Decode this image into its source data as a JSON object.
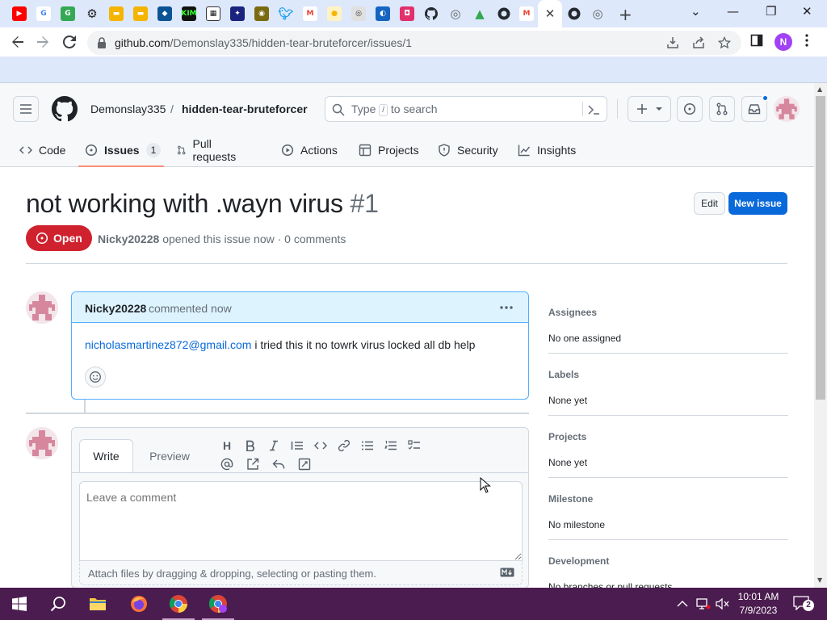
{
  "browser": {
    "tab_close": "✕",
    "new_tab": "+",
    "url_host": "github.com",
    "url_path": "/Demonslay335/hidden-tear-bruteforcer/issues/1",
    "profile_initial": "N",
    "window_controls": {
      "minimize": "—",
      "maximize": "❐",
      "close": "✕",
      "tab_search": "⌄"
    }
  },
  "github": {
    "owner": "Demonslay335",
    "slash": "/",
    "repo": "hidden-tear-bruteforcer",
    "search": {
      "type_text": "Type",
      "key": "/",
      "to_search": "to search"
    },
    "repo_nav": [
      {
        "label": "Code",
        "icon": "code-icon"
      },
      {
        "label": "Issues",
        "icon": "issue-opened-icon",
        "count": "1"
      },
      {
        "label": "Pull requests",
        "icon": "git-pull-request-icon"
      },
      {
        "label": "Actions",
        "icon": "play-icon"
      },
      {
        "label": "Projects",
        "icon": "table-icon"
      },
      {
        "label": "Security",
        "icon": "shield-icon"
      },
      {
        "label": "Insights",
        "icon": "graph-icon"
      }
    ]
  },
  "issue": {
    "title": "not working with .wayn virus",
    "number": "#1",
    "edit_label": "Edit",
    "new_issue_label": "New issue",
    "state": "Open",
    "author": "Nicky20228",
    "meta_text": "opened this issue now · 0 comments",
    "comment": {
      "author": "Nicky20228",
      "action": "commented now",
      "email": "nicholasmartinez872@gmail.com",
      "text": "i tried this it no towrk virus locked all db help"
    },
    "editor": {
      "tab_write": "Write",
      "tab_preview": "Preview",
      "placeholder": "Leave a comment",
      "attach_text": "Attach files by dragging & dropping, selecting or pasting them.",
      "heading_tool": "H"
    }
  },
  "sidebar": [
    {
      "label": "Assignees",
      "value": "No one assigned"
    },
    {
      "label": "Labels",
      "value": "None yet"
    },
    {
      "label": "Projects",
      "value": "None yet"
    },
    {
      "label": "Milestone",
      "value": "No milestone"
    },
    {
      "label": "Development",
      "value": "No branches or pull requests"
    }
  ],
  "taskbar": {
    "time": "10:01 AM",
    "date": "7/9/2023",
    "notification_count": "2"
  },
  "colors": {
    "accent_blue": "#0969da",
    "open_badge": "#cf222e",
    "taskbar": "#4b1c4f",
    "tab_strip": "#dee8fb"
  }
}
